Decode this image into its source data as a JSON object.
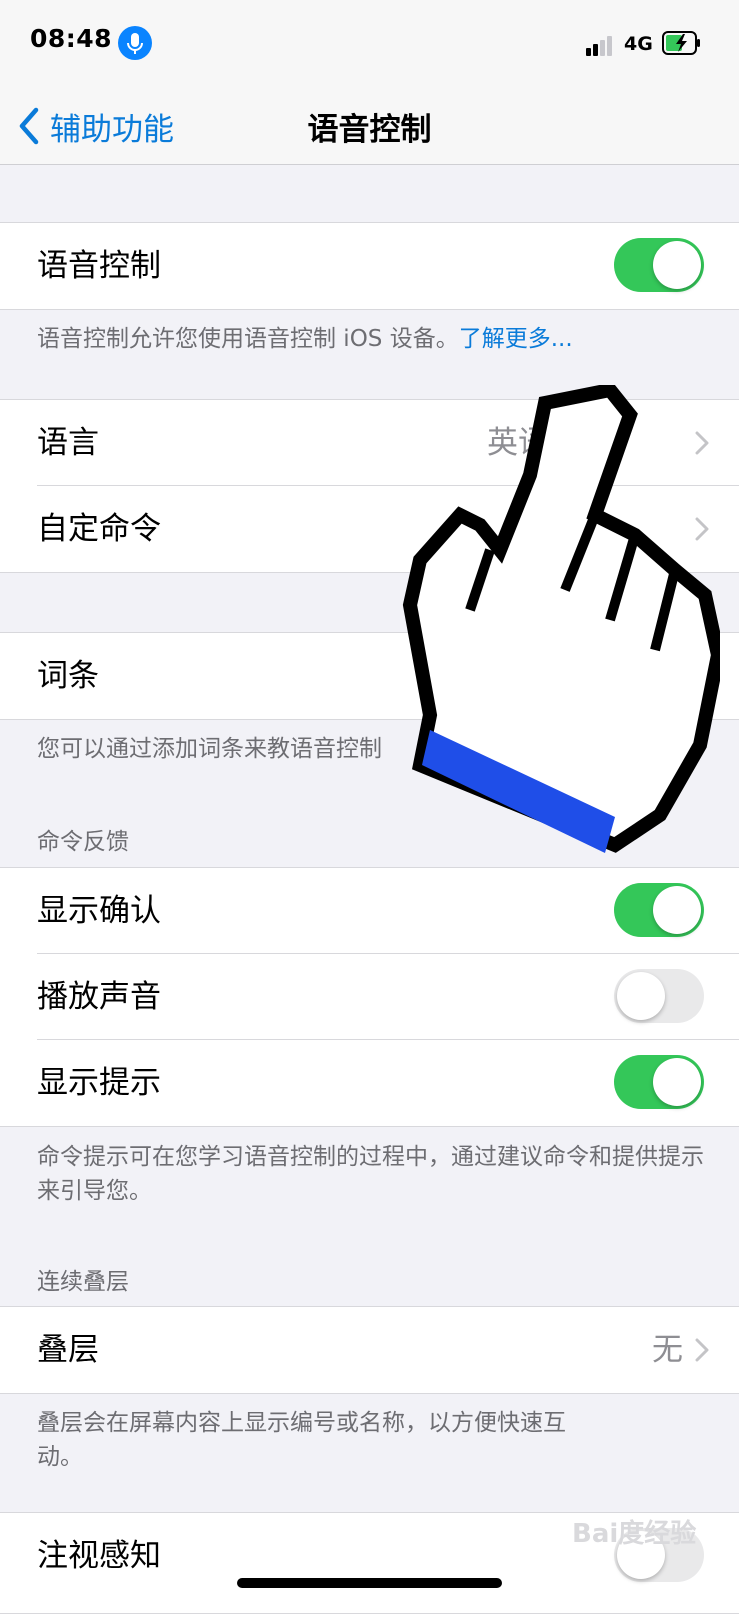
{
  "status_bar": {
    "time": "08:48",
    "network": "4G"
  },
  "nav": {
    "back_label": "辅助功能",
    "title": "语音控制"
  },
  "section_voice": {
    "label": "语音控制",
    "toggle_on": true
  },
  "note_voice": {
    "text": "语音控制允许您使用语音控制 iOS 设备。",
    "link": "了解更多..."
  },
  "section_language": {
    "language_label": "语言",
    "language_value": "英语",
    "custom_commands_label": "自定命令"
  },
  "section_vocab": {
    "label": "词条"
  },
  "note_vocab": {
    "text": "您可以通过添加词条来教语音控制"
  },
  "feedback_header": "命令反馈",
  "feedback": {
    "show_confirm": {
      "label": "显示确认",
      "toggle_on": true
    },
    "play_sound": {
      "label": "播放声音",
      "toggle_on": false
    },
    "show_hints": {
      "label": "显示提示",
      "toggle_on": true
    }
  },
  "note_feedback": {
    "text": "命令提示可在您学习语音控制的过程中，通过建议命令和提供提示来引导您。"
  },
  "overlay_header": "连续叠层",
  "overlay": {
    "label": "叠层",
    "value": "无"
  },
  "note_overlay": {
    "text": "叠层会在屏幕内容上显示编号或名称，以方便快速互动。"
  },
  "attention": {
    "label": "注视感知"
  },
  "watermark": "Bai度经验",
  "colors": {
    "accent": "#0a7bd9",
    "toggle_on": "#34c759",
    "background": "#f2f2f7"
  }
}
